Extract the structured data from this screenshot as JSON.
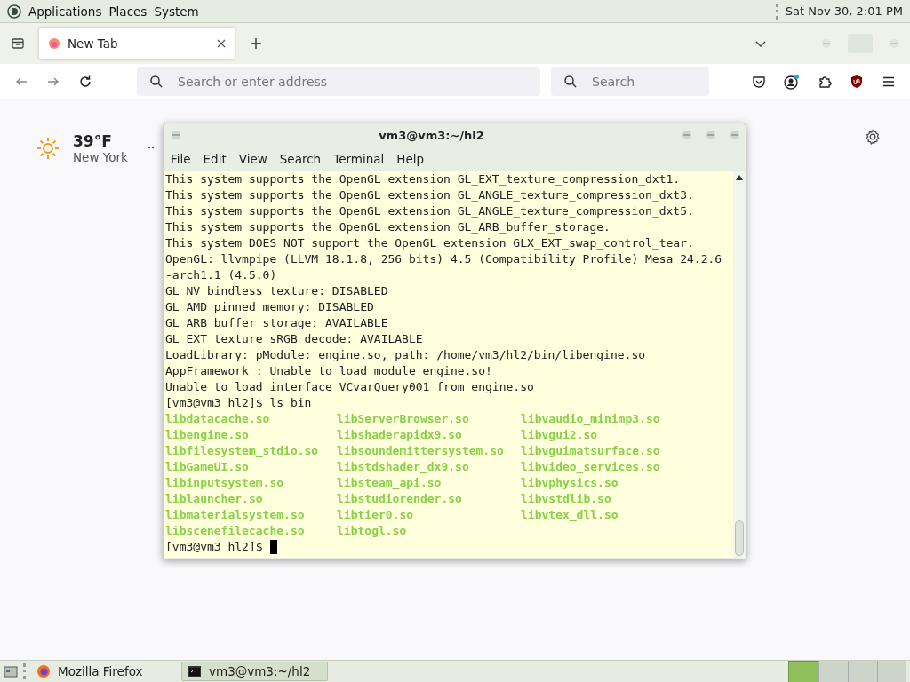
{
  "top_panel": {
    "menus": [
      "Applications",
      "Places",
      "System"
    ],
    "clock": "Sat Nov 30,  2:01 PM"
  },
  "browser": {
    "tabs": [
      {
        "label": "New Tab",
        "selected": true
      }
    ],
    "address_bar": {
      "placeholder": "Search or enter address"
    },
    "search_bar": {
      "placeholder": "Search"
    },
    "weather": {
      "temperature": "39°F",
      "city": "New York"
    }
  },
  "terminal": {
    "title": "vm3@vm3:~/hl2",
    "menu": [
      "File",
      "Edit",
      "View",
      "Search",
      "Terminal",
      "Help"
    ],
    "lines": [
      "This system supports the OpenGL extension GL_EXT_texture_compression_dxt1.",
      "This system supports the OpenGL extension GL_ANGLE_texture_compression_dxt3.",
      "This system supports the OpenGL extension GL_ANGLE_texture_compression_dxt5.",
      "This system supports the OpenGL extension GL_ARB_buffer_storage.",
      "This system DOES NOT support the OpenGL extension GLX_EXT_swap_control_tear.",
      "OpenGL: llvmpipe (LLVM 18.1.8, 256 bits) 4.5 (Compatibility Profile) Mesa 24.2.6",
      "-arch1.1 (4.5.0)",
      "GL_NV_bindless_texture: DISABLED",
      "GL_AMD_pinned_memory: DISABLED",
      "GL_ARB_buffer_storage: AVAILABLE",
      "GL_EXT_texture_sRGB_decode: AVAILABLE",
      "LoadLibrary: pModule: engine.so, path: /home/vm3/hl2/bin/libengine.so",
      "AppFramework : Unable to load module engine.so!",
      "Unable to load interface VCvarQuery001 from engine.so",
      "[vm3@vm3 hl2]$ ls bin"
    ],
    "files": [
      "libdatacache.so",
      "libengine.so",
      "libfilesystem_stdio.so",
      "libGameUI.so",
      "libinputsystem.so",
      "liblauncher.so",
      "libmaterialsystem.so",
      "libscenefilecache.so",
      "libServerBrowser.so",
      "libshaderapidx9.so",
      "libsoundemittersystem.so",
      "libstdshader_dx9.so",
      "libsteam_api.so",
      "libstudiorender.so",
      "libtier0.so",
      "libtogl.so",
      "libvaudio_minimp3.so",
      "libvgui2.so",
      "libvguimatsurface.so",
      "libvideo_services.so",
      "libvphysics.so",
      "libvstdlib.so",
      "libvtex_dll.so"
    ],
    "prompt": "[vm3@vm3 hl2]$"
  },
  "taskbar": {
    "tasks": [
      {
        "kind": "firefox",
        "label": "Mozilla Firefox",
        "selected": false
      },
      {
        "kind": "terminal",
        "label": "vm3@vm3:~/hl2",
        "selected": true
      }
    ]
  }
}
